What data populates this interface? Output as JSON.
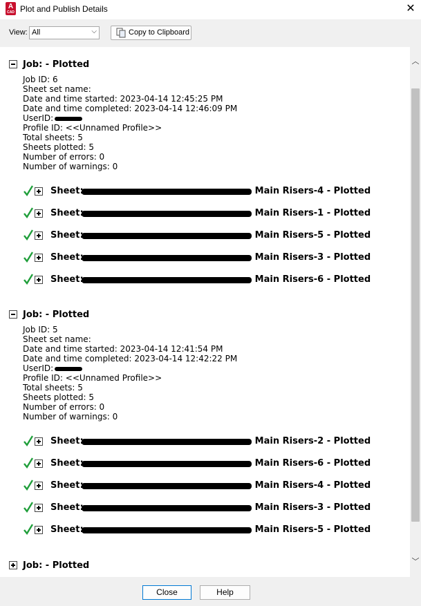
{
  "window": {
    "title": "Plot and Publish Details",
    "app_icon_letter": "A",
    "app_icon_sub": "CAD"
  },
  "toolbar": {
    "view_label": "View:",
    "view_value": "All",
    "copy_label": "Copy to Clipboard"
  },
  "jobs": [
    {
      "title": "Job: - Plotted",
      "expanded": true,
      "details": [
        "Job ID: 6",
        "Sheet set name:",
        "Date and time started: 2023-04-14 12:45:25 PM",
        "Date and time completed: 2023-04-14 12:46:09 PM",
        "UserID:",
        "Profile ID: <<Unnamed Profile>>",
        "Total sheets: 5",
        "Sheets plotted: 5",
        "Number of errors: 0",
        "Number of warnings: 0"
      ],
      "sheets": [
        {
          "prefix": "Sheet:",
          "suffix": "Main Risers-4 - Plotted"
        },
        {
          "prefix": "Sheet:",
          "suffix": "Main Risers-1 - Plotted"
        },
        {
          "prefix": "Sheet:",
          "suffix": "Main Risers-5 - Plotted"
        },
        {
          "prefix": "Sheet:",
          "suffix": "Main Risers-3 - Plotted"
        },
        {
          "prefix": "Sheet:",
          "suffix": "Main Risers-6 - Plotted"
        }
      ]
    },
    {
      "title": "Job: - Plotted",
      "expanded": true,
      "details": [
        "Job ID: 5",
        "Sheet set name:",
        "Date and time started: 2023-04-14 12:41:54 PM",
        "Date and time completed: 2023-04-14 12:42:22 PM",
        "UserID:",
        "Profile ID: <<Unnamed Profile>>",
        "Total sheets: 5",
        "Sheets plotted: 5",
        "Number of errors: 0",
        "Number of warnings: 0"
      ],
      "sheets": [
        {
          "prefix": "Sheet:",
          "suffix": "Main Risers-2 - Plotted"
        },
        {
          "prefix": "Sheet:",
          "suffix": "Main Risers-6 - Plotted"
        },
        {
          "prefix": "Sheet:",
          "suffix": "Main Risers-4 - Plotted"
        },
        {
          "prefix": "Sheet:",
          "suffix": "Main Risers-3 - Plotted"
        },
        {
          "prefix": "Sheet:",
          "suffix": "Main Risers-5 - Plotted"
        }
      ]
    },
    {
      "title": "Job: - Plotted",
      "expanded": false,
      "details": [],
      "sheets": []
    }
  ],
  "buttons": {
    "close": "Close",
    "help": "Help"
  },
  "colors": {
    "check": "#1f9e3a",
    "app_icon": "#c8102e",
    "focus": "#0078d4"
  }
}
